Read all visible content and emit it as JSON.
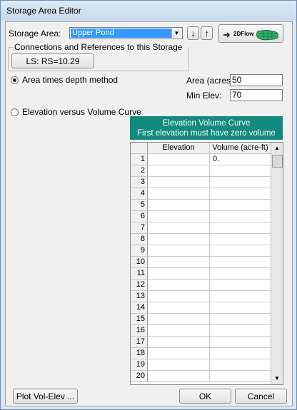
{
  "window": {
    "title": "Storage Area Editor"
  },
  "storage_area": {
    "label": "Storage Area:",
    "selected": "Upper Pond",
    "flow2d_label": "2DFlow"
  },
  "connections": {
    "legend": "Connections and References to this Storage Area",
    "item": "LS: RS=10.29"
  },
  "method": {
    "area_depth_label": "Area times depth method",
    "area_label": "Area (acres)",
    "area_value": "50",
    "min_elev_label": "Min Elev:",
    "min_elev_value": "70",
    "elev_volume_label": "Elevation versus Volume Curve",
    "selected": "area_depth"
  },
  "table": {
    "title1": "Elevation Volume Curve",
    "title2": "First elevation must have zero volume",
    "col_elevation": "Elevation",
    "col_volume": "Volume (acre-ft)",
    "rows": [
      {
        "n": "1",
        "elevation": "",
        "volume": "0."
      },
      {
        "n": "2",
        "elevation": "",
        "volume": ""
      },
      {
        "n": "3",
        "elevation": "",
        "volume": ""
      },
      {
        "n": "4",
        "elevation": "",
        "volume": ""
      },
      {
        "n": "5",
        "elevation": "",
        "volume": ""
      },
      {
        "n": "6",
        "elevation": "",
        "volume": ""
      },
      {
        "n": "7",
        "elevation": "",
        "volume": ""
      },
      {
        "n": "8",
        "elevation": "",
        "volume": ""
      },
      {
        "n": "9",
        "elevation": "",
        "volume": ""
      },
      {
        "n": "10",
        "elevation": "",
        "volume": ""
      },
      {
        "n": "11",
        "elevation": "",
        "volume": ""
      },
      {
        "n": "12",
        "elevation": "",
        "volume": ""
      },
      {
        "n": "13",
        "elevation": "",
        "volume": ""
      },
      {
        "n": "14",
        "elevation": "",
        "volume": ""
      },
      {
        "n": "15",
        "elevation": "",
        "volume": ""
      },
      {
        "n": "16",
        "elevation": "",
        "volume": ""
      },
      {
        "n": "17",
        "elevation": "",
        "volume": ""
      },
      {
        "n": "18",
        "elevation": "",
        "volume": ""
      },
      {
        "n": "19",
        "elevation": "",
        "volume": ""
      },
      {
        "n": "20",
        "elevation": "",
        "volume": ""
      }
    ]
  },
  "buttons": {
    "plot": "Plot Vol-Elev ...",
    "ok": "OK",
    "cancel": "Cancel"
  },
  "icons": {
    "down": "down-arrow-icon",
    "up": "up-arrow-icon",
    "flow2d": "2d-flow-area-icon",
    "dropdown": "chevron-down-icon"
  },
  "colors": {
    "table_header_bg": "#128a7d",
    "selection": "#3399ff",
    "flow_icon": "#2fb36a"
  }
}
